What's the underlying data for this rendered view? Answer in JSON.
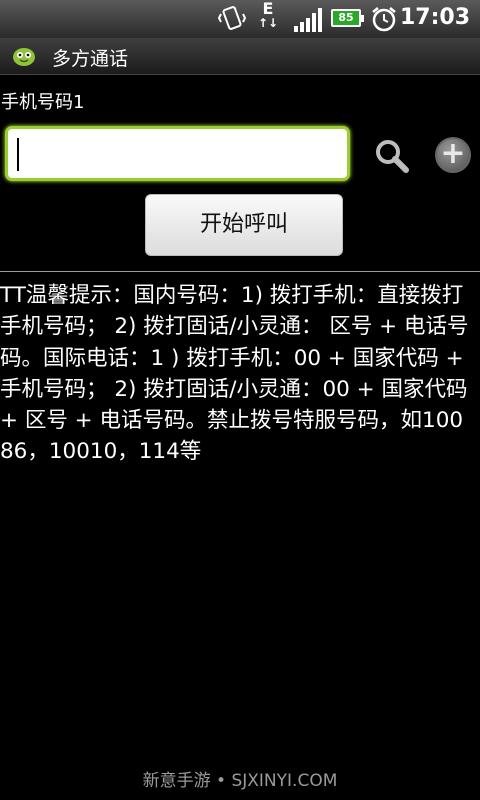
{
  "status_bar": {
    "time": "17:03",
    "battery_level": "85",
    "network_type": "E",
    "icons": [
      "vibrate-icon",
      "data-transfer-icon",
      "signal-icon",
      "battery-icon",
      "alarm-icon"
    ]
  },
  "app": {
    "title": "多方通话",
    "icon": "app-logo-icon"
  },
  "form": {
    "phone_label": "手机号码1",
    "phone_value": "",
    "search_icon": "search-icon",
    "add_icon": "add-icon",
    "start_button": "开始呼叫"
  },
  "tips": {
    "text": "TT温馨提示：国内号码：1) 拨打手机：直接拨打手机号码； 2) 拨打固话/小灵通： 区号 + 电话号码。国际电话：1 ) 拨打手机：00 + 国家代码 + 手机号码； 2) 拨打固话/小灵通：00 + 国家代码 + 区号 + 电话号码。禁止拨号特服号码，如10086，10010，114等"
  },
  "footer": {
    "watermark": "新意手游 • SJXINYI.COM"
  },
  "colors": {
    "input_focus": "#9acd32",
    "battery": "#2aa82a",
    "background": "#000000"
  }
}
